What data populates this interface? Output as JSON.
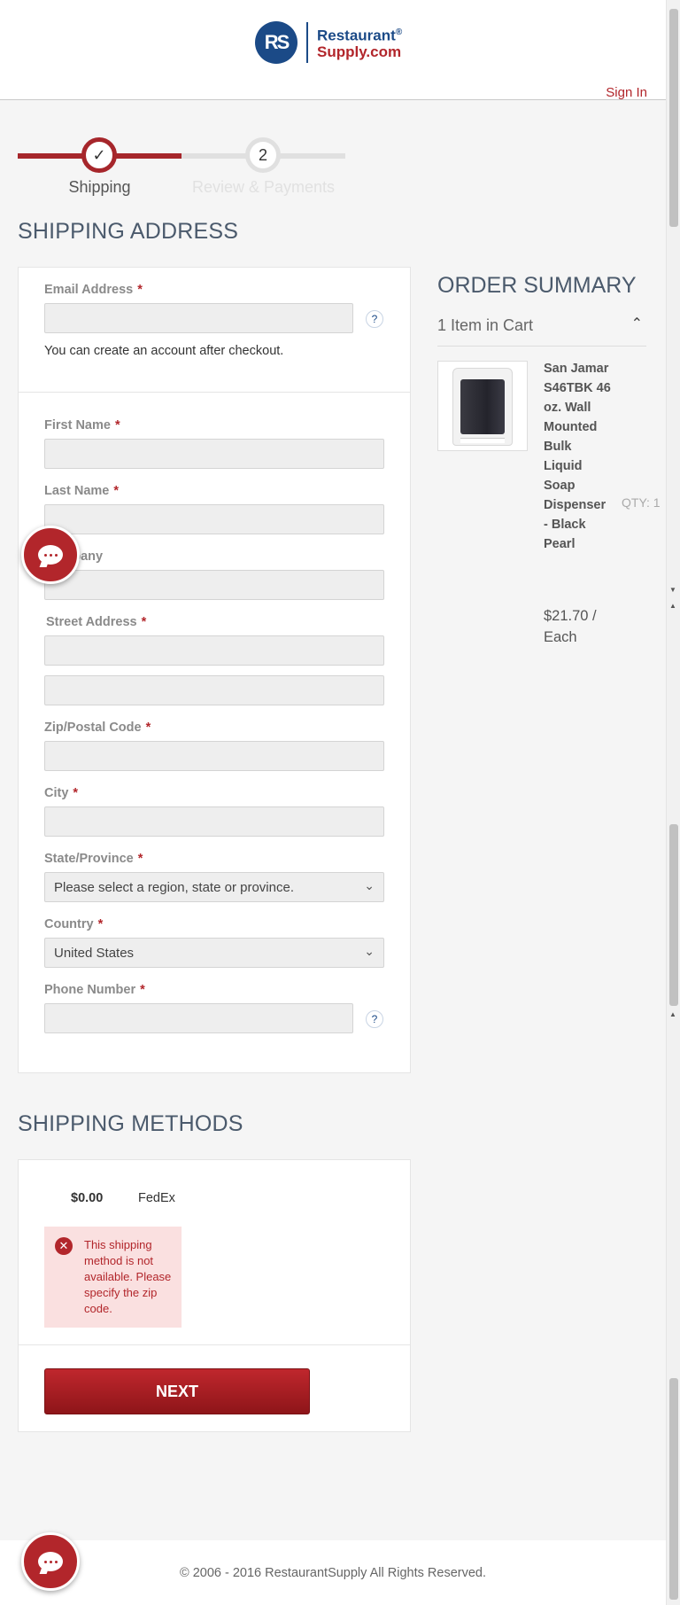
{
  "header": {
    "logo_initials": "RS",
    "logo_line1": "Restaurant",
    "logo_reg": "®",
    "logo_line2": "Supply.com",
    "sign_in": "Sign In"
  },
  "progress": {
    "step1_label": "Shipping",
    "step1_check": "✓",
    "step2_number": "2",
    "step2_label": "Review & Payments"
  },
  "shipping_address": {
    "title": "SHIPPING ADDRESS",
    "required_mark": "*",
    "help_glyph": "?",
    "email_label": "Email Address",
    "email_note": "You can create an account after checkout.",
    "first_name_label": "First Name",
    "last_name_label": "Last Name",
    "company_label": "Company",
    "street_label": "Street Address",
    "zip_label": "Zip/Postal Code",
    "city_label": "City",
    "state_label": "State/Province",
    "state_value": "Please select a region, state or province.",
    "country_label": "Country",
    "country_value": "United States",
    "phone_label": "Phone Number"
  },
  "order_summary": {
    "title": "ORDER SUMMARY",
    "cart_count": "1 Item in Cart",
    "product_name": "San Jamar S46TBK 46 oz. Wall Mounted Bulk Liquid Soap Dispenser - Black Pearl",
    "qty": "QTY: 1",
    "price": "$21.70 / Each"
  },
  "shipping_methods": {
    "title": "SHIPPING METHODS",
    "price": "$0.00",
    "carrier": "FedEx",
    "error": "This shipping method is not available. Please specify the zip code.",
    "next_button": "NEXT"
  },
  "footer": {
    "copyright": "© 2006 - 2016 RestaurantSupply All Rights Reserved."
  },
  "colors": {
    "brand_blue": "#1b4a87",
    "brand_red": "#b2262b",
    "heading_slate": "#4b5a6c"
  }
}
